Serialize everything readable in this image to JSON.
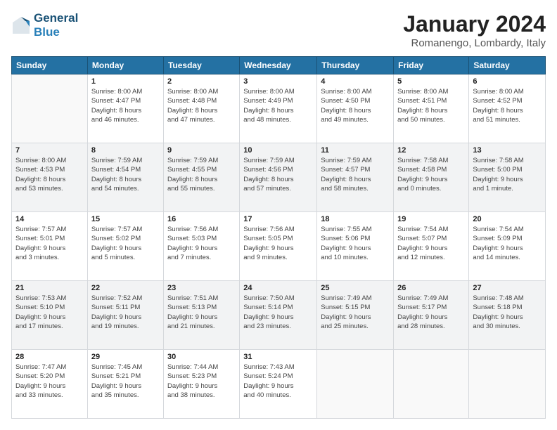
{
  "header": {
    "logo_line1": "General",
    "logo_line2": "Blue",
    "title": "January 2024",
    "subtitle": "Romanengo, Lombardy, Italy"
  },
  "columns": [
    "Sunday",
    "Monday",
    "Tuesday",
    "Wednesday",
    "Thursday",
    "Friday",
    "Saturday"
  ],
  "weeks": [
    [
      {
        "day": "",
        "info": ""
      },
      {
        "day": "1",
        "info": "Sunrise: 8:00 AM\nSunset: 4:47 PM\nDaylight: 8 hours\nand 46 minutes."
      },
      {
        "day": "2",
        "info": "Sunrise: 8:00 AM\nSunset: 4:48 PM\nDaylight: 8 hours\nand 47 minutes."
      },
      {
        "day": "3",
        "info": "Sunrise: 8:00 AM\nSunset: 4:49 PM\nDaylight: 8 hours\nand 48 minutes."
      },
      {
        "day": "4",
        "info": "Sunrise: 8:00 AM\nSunset: 4:50 PM\nDaylight: 8 hours\nand 49 minutes."
      },
      {
        "day": "5",
        "info": "Sunrise: 8:00 AM\nSunset: 4:51 PM\nDaylight: 8 hours\nand 50 minutes."
      },
      {
        "day": "6",
        "info": "Sunrise: 8:00 AM\nSunset: 4:52 PM\nDaylight: 8 hours\nand 51 minutes."
      }
    ],
    [
      {
        "day": "7",
        "info": "Sunrise: 8:00 AM\nSunset: 4:53 PM\nDaylight: 8 hours\nand 53 minutes."
      },
      {
        "day": "8",
        "info": "Sunrise: 7:59 AM\nSunset: 4:54 PM\nDaylight: 8 hours\nand 54 minutes."
      },
      {
        "day": "9",
        "info": "Sunrise: 7:59 AM\nSunset: 4:55 PM\nDaylight: 8 hours\nand 55 minutes."
      },
      {
        "day": "10",
        "info": "Sunrise: 7:59 AM\nSunset: 4:56 PM\nDaylight: 8 hours\nand 57 minutes."
      },
      {
        "day": "11",
        "info": "Sunrise: 7:59 AM\nSunset: 4:57 PM\nDaylight: 8 hours\nand 58 minutes."
      },
      {
        "day": "12",
        "info": "Sunrise: 7:58 AM\nSunset: 4:58 PM\nDaylight: 9 hours\nand 0 minutes."
      },
      {
        "day": "13",
        "info": "Sunrise: 7:58 AM\nSunset: 5:00 PM\nDaylight: 9 hours\nand 1 minute."
      }
    ],
    [
      {
        "day": "14",
        "info": "Sunrise: 7:57 AM\nSunset: 5:01 PM\nDaylight: 9 hours\nand 3 minutes."
      },
      {
        "day": "15",
        "info": "Sunrise: 7:57 AM\nSunset: 5:02 PM\nDaylight: 9 hours\nand 5 minutes."
      },
      {
        "day": "16",
        "info": "Sunrise: 7:56 AM\nSunset: 5:03 PM\nDaylight: 9 hours\nand 7 minutes."
      },
      {
        "day": "17",
        "info": "Sunrise: 7:56 AM\nSunset: 5:05 PM\nDaylight: 9 hours\nand 9 minutes."
      },
      {
        "day": "18",
        "info": "Sunrise: 7:55 AM\nSunset: 5:06 PM\nDaylight: 9 hours\nand 10 minutes."
      },
      {
        "day": "19",
        "info": "Sunrise: 7:54 AM\nSunset: 5:07 PM\nDaylight: 9 hours\nand 12 minutes."
      },
      {
        "day": "20",
        "info": "Sunrise: 7:54 AM\nSunset: 5:09 PM\nDaylight: 9 hours\nand 14 minutes."
      }
    ],
    [
      {
        "day": "21",
        "info": "Sunrise: 7:53 AM\nSunset: 5:10 PM\nDaylight: 9 hours\nand 17 minutes."
      },
      {
        "day": "22",
        "info": "Sunrise: 7:52 AM\nSunset: 5:11 PM\nDaylight: 9 hours\nand 19 minutes."
      },
      {
        "day": "23",
        "info": "Sunrise: 7:51 AM\nSunset: 5:13 PM\nDaylight: 9 hours\nand 21 minutes."
      },
      {
        "day": "24",
        "info": "Sunrise: 7:50 AM\nSunset: 5:14 PM\nDaylight: 9 hours\nand 23 minutes."
      },
      {
        "day": "25",
        "info": "Sunrise: 7:49 AM\nSunset: 5:15 PM\nDaylight: 9 hours\nand 25 minutes."
      },
      {
        "day": "26",
        "info": "Sunrise: 7:49 AM\nSunset: 5:17 PM\nDaylight: 9 hours\nand 28 minutes."
      },
      {
        "day": "27",
        "info": "Sunrise: 7:48 AM\nSunset: 5:18 PM\nDaylight: 9 hours\nand 30 minutes."
      }
    ],
    [
      {
        "day": "28",
        "info": "Sunrise: 7:47 AM\nSunset: 5:20 PM\nDaylight: 9 hours\nand 33 minutes."
      },
      {
        "day": "29",
        "info": "Sunrise: 7:45 AM\nSunset: 5:21 PM\nDaylight: 9 hours\nand 35 minutes."
      },
      {
        "day": "30",
        "info": "Sunrise: 7:44 AM\nSunset: 5:23 PM\nDaylight: 9 hours\nand 38 minutes."
      },
      {
        "day": "31",
        "info": "Sunrise: 7:43 AM\nSunset: 5:24 PM\nDaylight: 9 hours\nand 40 minutes."
      },
      {
        "day": "",
        "info": ""
      },
      {
        "day": "",
        "info": ""
      },
      {
        "day": "",
        "info": ""
      }
    ]
  ]
}
